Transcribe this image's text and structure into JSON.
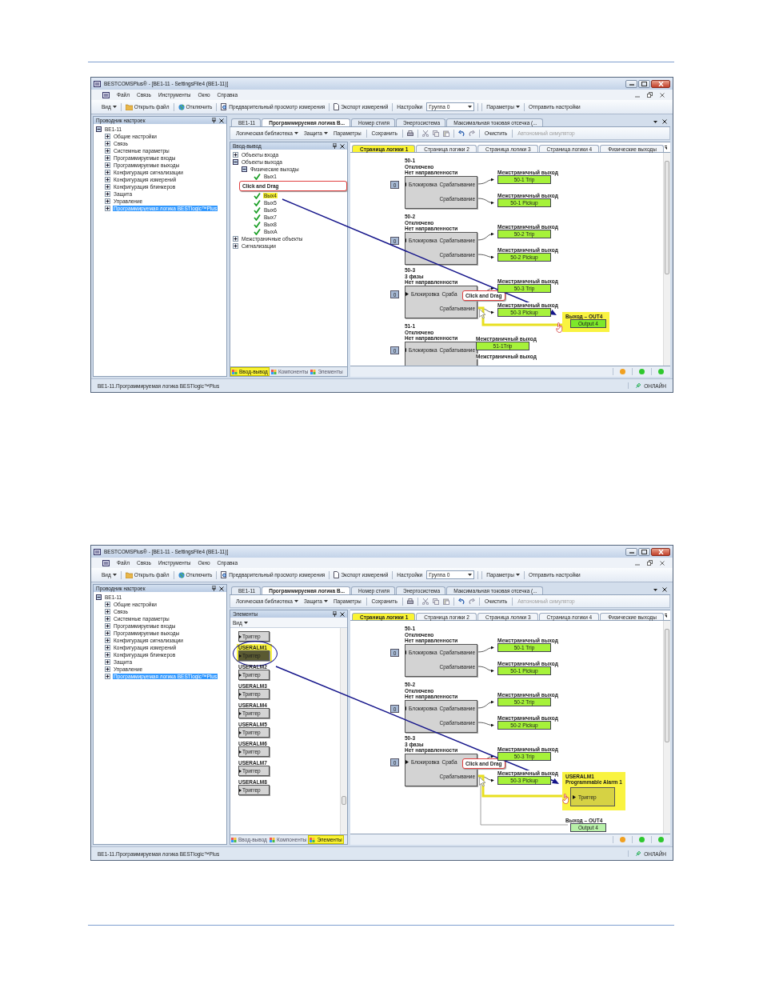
{
  "windows": [
    {
      "title": "BESTCOMSPlus® - [BE1-11 - SettingsFile4 (BE1-11)]",
      "menu": [
        "Файл",
        "Связь",
        "Инструменты",
        "Окно",
        "Справка"
      ],
      "toolbar": [
        {
          "label": "Вид",
          "dropdown": true
        },
        {
          "label": "Открыть файл",
          "dropdown": false
        },
        {
          "label": "Отключить",
          "dropdown": false
        },
        {
          "label": "Предварительный просмотр измерения",
          "dropdown": false
        },
        {
          "label": "Экспорт измерений",
          "dropdown": false
        },
        {
          "label": "Настройки",
          "dropdown": false
        }
      ],
      "group_select": {
        "value": "Группа 0"
      },
      "toolbar_right": [
        {
          "label": "Параметры",
          "dropdown": true
        },
        {
          "label": "Отправить настройки",
          "dropdown": false
        }
      ],
      "explorer": {
        "title": "Проводник настроек",
        "tree": [
          {
            "label": "BE1-11",
            "expanded": true,
            "selected": false,
            "children": [
              {
                "label": "Общие настройки",
                "expanded": false,
                "selected": false
              },
              {
                "label": "Связь",
                "expanded": false,
                "selected": false
              },
              {
                "label": "Системные параметры",
                "expanded": false,
                "selected": false
              },
              {
                "label": "Программируемые входы",
                "expanded": false,
                "selected": false
              },
              {
                "label": "Программируемые выходы",
                "expanded": false,
                "selected": false
              },
              {
                "label": "Конфигурация сигнализации",
                "expanded": false,
                "selected": false
              },
              {
                "label": "Конфигурация измерений",
                "expanded": false,
                "selected": false
              },
              {
                "label": "Конфигурация блинкеров",
                "expanded": false,
                "selected": false
              },
              {
                "label": "Защита",
                "expanded": false,
                "selected": false
              },
              {
                "label": "Управление",
                "expanded": false,
                "selected": false
              },
              {
                "label": "Программируемая логика BESTlogic™Plus",
                "expanded": false,
                "selected": true
              }
            ]
          }
        ]
      },
      "doc_tabs": [
        {
          "label": "BE1-11",
          "selected": false
        },
        {
          "label": "Программируемая логика B...",
          "selected": true
        },
        {
          "label": "Номер стиля",
          "selected": false
        },
        {
          "label": "Энергосистема",
          "selected": false
        },
        {
          "label": "Максимальная токовая отсечка (...",
          "selected": false
        }
      ],
      "logic_toolbar": [
        {
          "label": "Логическая библиотека",
          "dropdown": true,
          "disabled": false
        },
        {
          "label": "Защита",
          "dropdown": true,
          "disabled": false
        },
        {
          "label": "Параметры",
          "dropdown": false,
          "disabled": false
        },
        {
          "label": "Сохранить",
          "dropdown": false,
          "disabled": false
        },
        {
          "label": "Очистить",
          "dropdown": false,
          "disabled": false
        },
        {
          "label": "Автономный симулятор",
          "dropdown": false,
          "disabled": true
        }
      ],
      "side_panel": {
        "kind": "tree",
        "title": "Ввод-вывод",
        "items": [
          {
            "kind": "node",
            "label": "Объекты входа",
            "expanded": false
          },
          {
            "kind": "node",
            "label": "Объекты выхода",
            "expanded": true,
            "children": [
              {
                "kind": "node",
                "label": "Физические выходы",
                "expanded": true,
                "children": [
                  {
                    "kind": "output",
                    "label": "Вых1",
                    "selected": false
                  },
                  {
                    "kind": "callout",
                    "label": "Click and Drag"
                  },
                  {
                    "kind": "output",
                    "label": "Вых4",
                    "selected": true
                  },
                  {
                    "kind": "output",
                    "label": "Вых5",
                    "selected": false
                  },
                  {
                    "kind": "output",
                    "label": "Вых6",
                    "selected": false
                  },
                  {
                    "kind": "output",
                    "label": "Вых7",
                    "selected": false
                  },
                  {
                    "kind": "output",
                    "label": "Вых8",
                    "selected": false
                  },
                  {
                    "kind": "output",
                    "label": "ВыхА",
                    "selected": false
                  }
                ]
              }
            ]
          },
          {
            "kind": "node",
            "label": "Межстраничные объекты",
            "expanded": false
          },
          {
            "kind": "node",
            "label": "Сигнализации",
            "expanded": false
          }
        ]
      },
      "panel_tabs": [
        {
          "label": "Ввод-вывод",
          "selected": true
        },
        {
          "label": "Компоненты",
          "selected": false
        },
        {
          "label": "Элементы",
          "selected": false
        }
      ],
      "page_tabs": [
        {
          "label": "Страница логики 1",
          "selected": true
        },
        {
          "label": "Страница логики 2",
          "selected": false
        },
        {
          "label": "Страница логики 3",
          "selected": false
        },
        {
          "label": "Страница логики 4",
          "selected": false
        },
        {
          "label": "Физические выходы",
          "selected": false
        }
      ],
      "canvas": {
        "blocks": [
          {
            "lines": [
              "50-1",
              "Отключено",
              "Нет направленности"
            ],
            "input_value": "0",
            "input_label": "Блокировка",
            "outputs": [
              "Срабатывание",
              "Срабатывание"
            ]
          },
          {
            "lines": [
              "50-2",
              "Отключено",
              "Нет направленности"
            ],
            "input_value": "0",
            "input_label": "Блокировка",
            "outputs": [
              "Срабатывание",
              "Срабатывание"
            ]
          },
          {
            "lines": [
              "50-3",
              "3 фазы",
              "Нет направленности"
            ],
            "input_value": "0",
            "input_label": "Блокировка",
            "outputs": [
              "Сраба",
              "Срабатывание"
            ]
          },
          {
            "lines": [
              "51-1",
              "Отключено",
              "Нет направленности"
            ],
            "input_value": "0",
            "input_label": "Блокировка",
            "outputs": [
              "Срабатывание"
            ]
          }
        ],
        "links": [
          {
            "header": "Межстраничный выход",
            "label": "50-1 Trip"
          },
          {
            "header": "Межстраничный выход",
            "label": "50-1 Pickup"
          },
          {
            "header": "Межстраничный выход",
            "label": "50-2 Trip"
          },
          {
            "header": "Межстраничный выход",
            "label": "50-2 Pickup"
          },
          {
            "header": "Межстраничный выход",
            "label": "50-3 Trip"
          },
          {
            "header": "Межстраничный выход",
            "label": "50-3 Pickup"
          },
          {
            "header": "Межстраничный выход",
            "label": "51-1Trip"
          },
          {
            "header": "Межстраничный выход"
          }
        ],
        "targets": [
          {
            "kind": "output",
            "highlighted": true,
            "header": "Выход – OUT4",
            "label": "Output 4"
          }
        ],
        "callout": "Click and Drag"
      },
      "indicators": [
        {
          "color": "#f0a020"
        },
        {
          "color": "#2ec82e"
        },
        {
          "color": "#2ec82e"
        }
      ],
      "status": {
        "path": "BE1-11.Программируемая логика BESTlogic™Plus",
        "connection": "ОНЛАЙН"
      }
    },
    {
      "title": "BESTCOMSPlus® - [BE1-11 - SettingsFile4 (BE1-11)]",
      "menu": [
        "Файл",
        "Связь",
        "Инструменты",
        "Окно",
        "Справка"
      ],
      "toolbar": [
        {
          "label": "Вид",
          "dropdown": true
        },
        {
          "label": "Открыть файл",
          "dropdown": false
        },
        {
          "label": "Отключить",
          "dropdown": false
        },
        {
          "label": "Предварительный просмотр измерения",
          "dropdown": false
        },
        {
          "label": "Экспорт измерений",
          "dropdown": false
        },
        {
          "label": "Настройки",
          "dropdown": false
        }
      ],
      "group_select": {
        "value": "Группа 0"
      },
      "toolbar_right": [
        {
          "label": "Параметры",
          "dropdown": true
        },
        {
          "label": "Отправить настройки",
          "dropdown": false
        }
      ],
      "explorer": {
        "title": "Проводник настроек",
        "tree": [
          {
            "label": "BE1-11",
            "expanded": true,
            "selected": false,
            "children": [
              {
                "label": "Общие настройки",
                "expanded": false,
                "selected": false
              },
              {
                "label": "Связь",
                "expanded": false,
                "selected": false
              },
              {
                "label": "Системные параметры",
                "expanded": false,
                "selected": false
              },
              {
                "label": "Программируемые входы",
                "expanded": false,
                "selected": false
              },
              {
                "label": "Программируемые выходы",
                "expanded": false,
                "selected": false
              },
              {
                "label": "Конфигурация сигнализации",
                "expanded": false,
                "selected": false
              },
              {
                "label": "Конфигурация измерений",
                "expanded": false,
                "selected": false
              },
              {
                "label": "Конфигурация блинкеров",
                "expanded": false,
                "selected": false
              },
              {
                "label": "Защита",
                "expanded": false,
                "selected": false
              },
              {
                "label": "Управление",
                "expanded": false,
                "selected": false
              },
              {
                "label": "Программируемая логика BESTlogic™Plus",
                "expanded": false,
                "selected": true
              }
            ]
          }
        ]
      },
      "doc_tabs": [
        {
          "label": "BE1-11",
          "selected": false
        },
        {
          "label": "Программируемая логика B...",
          "selected": true
        },
        {
          "label": "Номер стиля",
          "selected": false
        },
        {
          "label": "Энергосистема",
          "selected": false
        },
        {
          "label": "Максимальная токовая отсечка (...",
          "selected": false
        }
      ],
      "logic_toolbar": [
        {
          "label": "Логическая библиотека",
          "dropdown": true,
          "disabled": false
        },
        {
          "label": "Защита",
          "dropdown": true,
          "disabled": false
        },
        {
          "label": "Параметры",
          "dropdown": false,
          "disabled": false
        },
        {
          "label": "Сохранить",
          "dropdown": false,
          "disabled": false
        },
        {
          "label": "Очистить",
          "dropdown": false,
          "disabled": false
        },
        {
          "label": "Автономный симулятор",
          "dropdown": false,
          "disabled": true
        }
      ],
      "side_panel": {
        "kind": "palette",
        "title": "Элементы",
        "view_button": "Вид",
        "items": [
          {
            "label": "Триггер",
            "selected": false
          },
          {
            "title": "USERALM1",
            "label": "Триггер",
            "selected": true
          },
          {
            "title": "USERALM2",
            "label": "Триггер",
            "selected": false
          },
          {
            "title": "USERALM3",
            "label": "Триггер",
            "selected": false
          },
          {
            "title": "USERALM4",
            "label": "Триггер",
            "selected": false
          },
          {
            "title": "USERALM5",
            "label": "Триггер",
            "selected": false
          },
          {
            "title": "USERALM6",
            "label": "Триггер",
            "selected": false
          },
          {
            "title": "USERALM7",
            "label": "Триггер",
            "selected": false
          },
          {
            "title": "USERALM8",
            "label": "Триггер",
            "selected": false
          }
        ]
      },
      "panel_tabs": [
        {
          "label": "Ввод-вывод",
          "selected": false
        },
        {
          "label": "Компоненты",
          "selected": false
        },
        {
          "label": "Элементы",
          "selected": true
        }
      ],
      "page_tabs": [
        {
          "label": "Страница логики 1",
          "selected": true
        },
        {
          "label": "Страница логики 2",
          "selected": false
        },
        {
          "label": "Страница логики 3",
          "selected": false
        },
        {
          "label": "Страница логики 4",
          "selected": false
        },
        {
          "label": "Физические выходы",
          "selected": false
        }
      ],
      "canvas": {
        "blocks": [
          {
            "lines": [
              "50-1",
              "Отключено",
              "Нет направленности"
            ],
            "input_value": "0",
            "input_label": "Блокировка",
            "outputs": [
              "Срабатывание",
              "Срабатывание"
            ]
          },
          {
            "lines": [
              "50-2",
              "Отключено",
              "Нет направленности"
            ],
            "input_value": "0",
            "input_label": "Блокировка",
            "outputs": [
              "Срабатывание",
              "Срабатывание"
            ]
          },
          {
            "lines": [
              "50-3",
              "3 фазы",
              "Нет направленности"
            ],
            "input_value": "0",
            "input_label": "Блокировка",
            "outputs": [
              "Сраба",
              "Срабатывание"
            ]
          }
        ],
        "links": [
          {
            "header": "Межстраничный выход",
            "label": "50-1 Trip"
          },
          {
            "header": "Межстраничный выход",
            "label": "50-1 Pickup"
          },
          {
            "header": "Межстраничный выход",
            "label": "50-2 Trip"
          },
          {
            "header": "Межстраничный выход",
            "label": "50-2 Pickup"
          },
          {
            "header": "Межстраничный выход",
            "label": "50-3 Trip"
          },
          {
            "header": "Межстраничный выход",
            "label": "50-3 Pickup"
          }
        ],
        "targets": [
          {
            "kind": "alarm",
            "highlighted": true,
            "lines": [
              "USERALM1",
              "Programmable Alarm 1"
            ],
            "input": "Триггер"
          },
          {
            "kind": "output",
            "highlighted": false,
            "header": "Выход – OUT4",
            "label": "Output 4"
          }
        ],
        "callout": "Click and Drag"
      },
      "indicators": [
        {
          "color": "#f0a020"
        },
        {
          "color": "#2ec82e"
        },
        {
          "color": "#2ec82e"
        }
      ],
      "status": {
        "path": "BE1-11.Программируемая логика BESTlogic™Plus",
        "connection": "ОНЛАЙН"
      }
    }
  ]
}
